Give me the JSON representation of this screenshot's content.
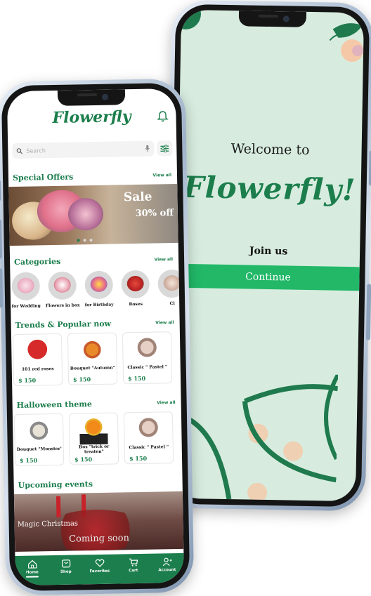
{
  "welcome_screen": {
    "title": "Welcome to",
    "brand": "Flowerfly!",
    "join_label": "Join us",
    "continue_label": "Continue"
  },
  "home_screen": {
    "logo": "Flowerfly",
    "search": {
      "placeholder": "Search"
    },
    "special_offers": {
      "title": "Special Offers",
      "view_all": "View all",
      "banner": {
        "headline": "Sale",
        "discount": "30% off"
      }
    },
    "categories": {
      "title": "Categories",
      "view_all": "View all",
      "items": [
        {
          "label": "for Wedding"
        },
        {
          "label": "Flowers in box"
        },
        {
          "label": "for Birthday"
        },
        {
          "label": "Roses"
        },
        {
          "label": "Cl"
        }
      ]
    },
    "trends": {
      "title": "Trends & Popular now",
      "view_all": "View all",
      "items": [
        {
          "name": "101 red roses",
          "price": "$ 150"
        },
        {
          "name": "Bouquet \"Autumn\"",
          "price": "$ 150"
        },
        {
          "name": "Classic \" Pastel \"",
          "price": "$ 150"
        }
      ]
    },
    "halloween": {
      "title": "Halloween theme",
      "view_all": "View all",
      "items": [
        {
          "name": "Bouquet \"Monster\"",
          "price": "$ 150"
        },
        {
          "name": "Box \"trick or treaten\"",
          "price": "$ 150"
        },
        {
          "name": "Classic \" Pastel \"",
          "price": "$ 150"
        }
      ]
    },
    "events": {
      "title": "Upcoming events",
      "card_title": "Magic Christmas",
      "card_subtitle": "Coming soon"
    },
    "tabbar": {
      "home": "Home",
      "shop": "Shop",
      "favorites": "Favorites",
      "cart": "Cart",
      "account": "Account"
    }
  },
  "colors": {
    "brand_green": "#1c7e4c",
    "continue_green": "#22b868",
    "welcome_bg": "#d7ecdf"
  }
}
